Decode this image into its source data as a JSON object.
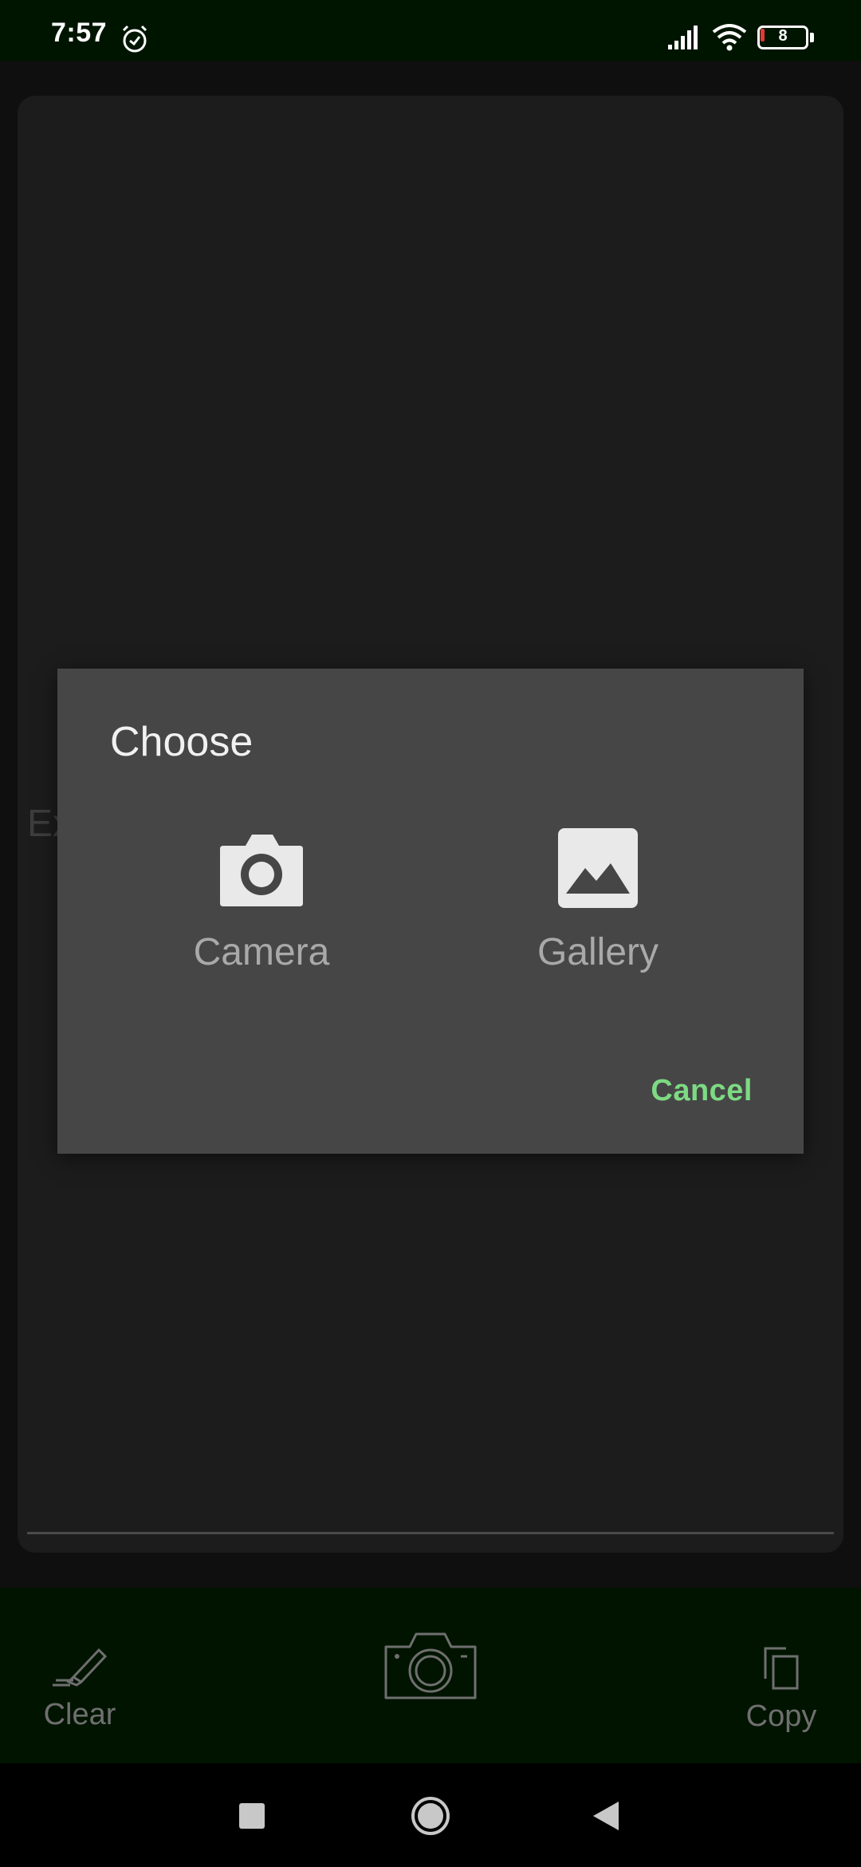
{
  "status_bar": {
    "time": "7:57",
    "battery_level": "8",
    "icons": [
      "alarm-icon",
      "signal-icon",
      "wifi-icon",
      "battery-icon"
    ]
  },
  "background": {
    "hint_text": "Ex"
  },
  "dialog": {
    "title": "Choose",
    "options": [
      {
        "label": "Camera",
        "icon": "camera-icon"
      },
      {
        "label": "Gallery",
        "icon": "image-icon"
      }
    ],
    "cancel_label": "Cancel",
    "accent_color": "#7dda83"
  },
  "toolbar": {
    "clear_label": "Clear",
    "copy_label": "Copy"
  },
  "nav": {
    "icons": [
      "recents-icon",
      "home-icon",
      "back-icon"
    ]
  }
}
